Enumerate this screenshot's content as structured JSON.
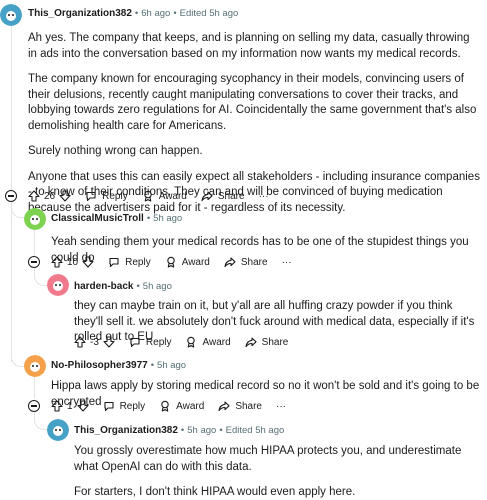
{
  "comments": [
    {
      "username": "This_Organization382",
      "time": "6h ago",
      "edited": "Edited 5h ago",
      "paragraphs": [
        "Ah yes. The company that keeps, and is planning on selling my data, casually throwing in ads into the conversation based on my information now wants my medical records.",
        "The company known for encouraging sycophancy in their models, convincing users of their delusions, recently caught manipulating conversations to cover their tracks, and lobbying towards zero regulations for AI. Coincidentally the same government that's also demolishing health care for Americans.",
        "Surely nothing wrong can happen.",
        "Anyone that uses this can easily expect all stakeholders - including insurance companies - to know of their conditions. They can and will be convinced of buying medication because the advertisers paid for it - regardless of its necessity."
      ],
      "score": "26",
      "avatar_color": "#46a1c7"
    },
    {
      "username": "ClassicalMusicTroll",
      "time": "5h ago",
      "paragraphs": [
        "Yeah sending them your medical records has to be one of the stupidest things you could do"
      ],
      "score": "10",
      "avatar_color": "#7dd34f"
    },
    {
      "username": "harden-back",
      "time": "5h ago",
      "paragraphs": [
        "they can maybe train on it, but y'all are all huffing crazy powder if you think they'll sell it. we absolutely don't fuck around with medical data, especially if it's rolled out to EU"
      ],
      "score": "-3",
      "avatar_color": "#f07a8c"
    },
    {
      "username": "No-Philosopher3977",
      "time": "5h ago",
      "paragraphs": [
        "Hippa laws apply by storing medical record so no it won't be sold and it's going to be encrypted"
      ],
      "score": "1",
      "avatar_color": "#f5a04a"
    },
    {
      "username": "This_Organization382",
      "time": "5h ago",
      "edited": "Edited 5h ago",
      "paragraphs": [
        "You grossly overestimate how much HIPAA protects you, and underestimate what OpenAI can do with this data.",
        "For starters, I don't think HIPAA would even apply here."
      ],
      "avatar_color": "#46a1c7"
    }
  ],
  "actions": {
    "reply": "Reply",
    "award": "Award",
    "share": "Share",
    "more": "···",
    "dot": "•"
  }
}
